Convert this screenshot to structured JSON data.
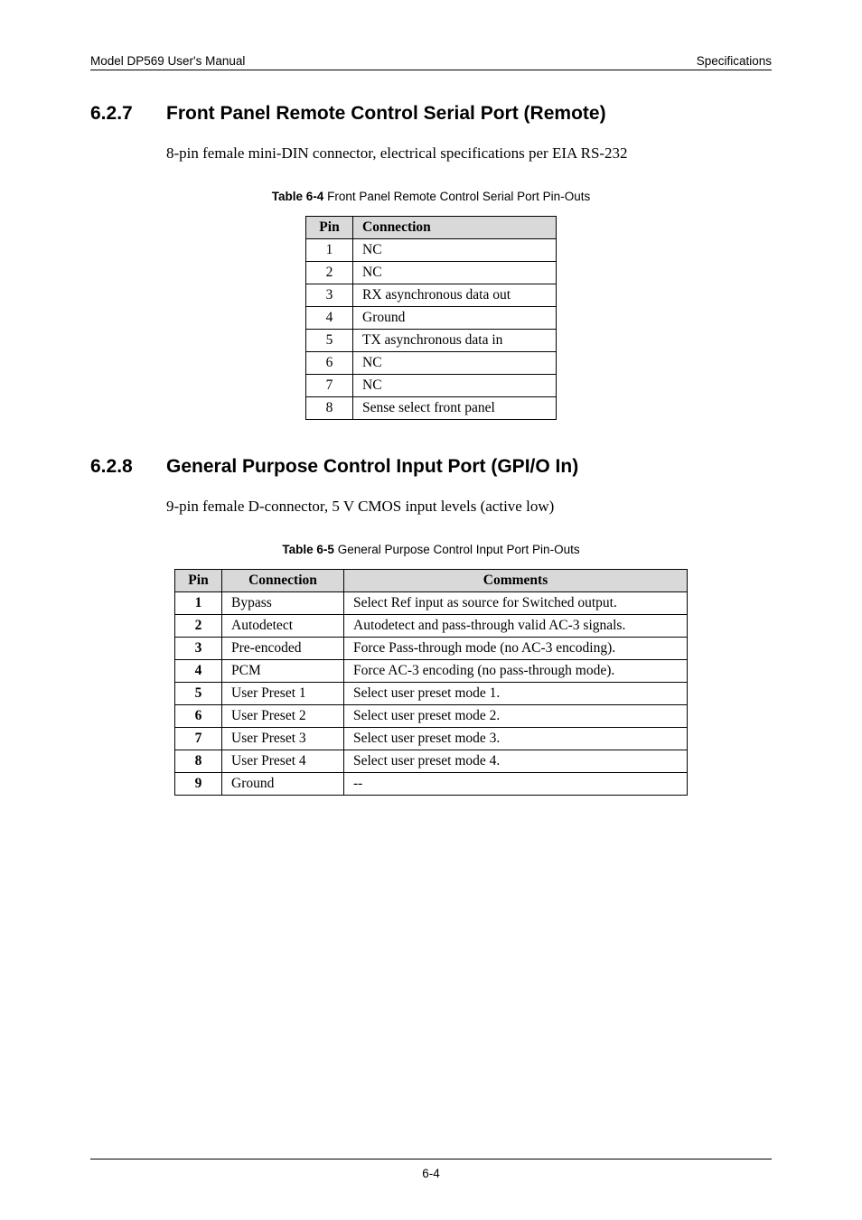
{
  "header": {
    "left": "Model DP569 User's Manual",
    "right": "Specifications"
  },
  "section1": {
    "number": "6.2.7",
    "title": "Front Panel Remote Control Serial Port (Remote)",
    "body": "8-pin female mini-DIN connector, electrical specifications per EIA RS-232",
    "table_caption_bold": "Table 6-4",
    "table_caption_rest": " Front Panel Remote Control Serial Port Pin-Outs",
    "headers": {
      "pin": "Pin",
      "connection": "Connection"
    },
    "rows": [
      {
        "pin": "1",
        "conn": "NC"
      },
      {
        "pin": "2",
        "conn": "NC"
      },
      {
        "pin": "3",
        "conn": "RX asynchronous data out"
      },
      {
        "pin": "4",
        "conn": "Ground"
      },
      {
        "pin": "5",
        "conn": "TX asynchronous data in"
      },
      {
        "pin": "6",
        "conn": "NC"
      },
      {
        "pin": "7",
        "conn": "NC"
      },
      {
        "pin": "8",
        "conn": "Sense select front panel"
      }
    ]
  },
  "section2": {
    "number": "6.2.8",
    "title": "General Purpose Control Input Port (GPI/O In)",
    "body": "9-pin female D-connector, 5 V CMOS input levels (active low)",
    "table_caption_bold": "Table 6-5",
    "table_caption_rest": " General Purpose Control Input Port Pin-Outs",
    "headers": {
      "pin": "Pin",
      "connection": "Connection",
      "comments": "Comments"
    },
    "rows": [
      {
        "pin": "1",
        "conn": "Bypass",
        "comm": "Select Ref input as source for Switched output."
      },
      {
        "pin": "2",
        "conn": "Autodetect",
        "comm": "Autodetect and pass-through valid AC-3 signals."
      },
      {
        "pin": "3",
        "conn": "Pre-encoded",
        "comm": "Force Pass-through mode (no AC-3 encoding)."
      },
      {
        "pin": "4",
        "conn": "PCM",
        "comm": "Force AC-3 encoding (no pass-through mode)."
      },
      {
        "pin": "5",
        "conn": "User Preset 1",
        "comm": "Select user preset mode 1."
      },
      {
        "pin": "6",
        "conn": "User Preset 2",
        "comm": "Select user preset mode 2."
      },
      {
        "pin": "7",
        "conn": "User Preset 3",
        "comm": "Select user preset mode 3."
      },
      {
        "pin": "8",
        "conn": "User Preset 4",
        "comm": "Select user preset mode 4."
      },
      {
        "pin": "9",
        "conn": "Ground",
        "comm": "--"
      }
    ]
  },
  "footer": {
    "page": "6-4"
  }
}
